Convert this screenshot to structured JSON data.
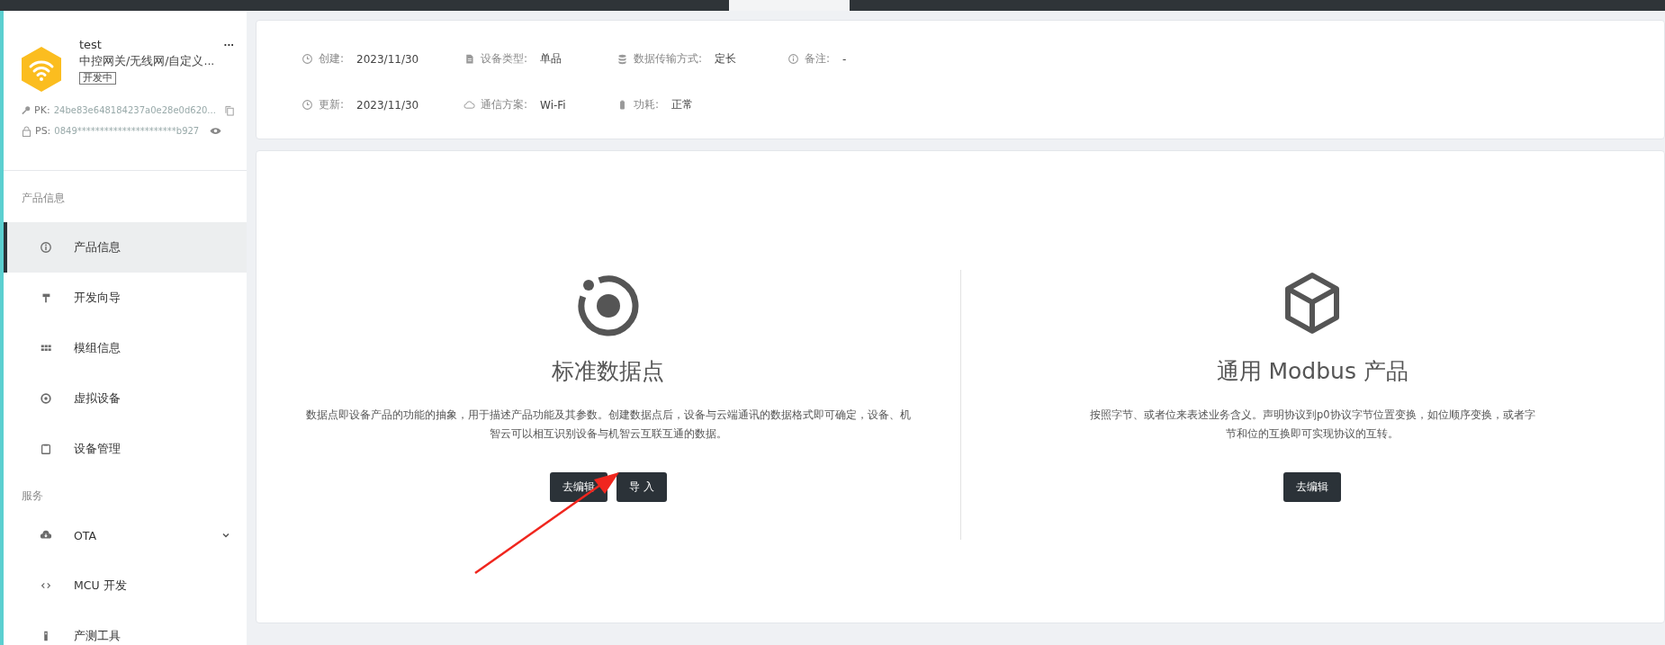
{
  "product": {
    "name": "test",
    "category": "中控网关/无线网/自定义...",
    "status_badge": "开发中",
    "more": "...",
    "pk_label": "PK:",
    "pk_value": "24be83e648184237a0e28e0d620...",
    "ps_label": "PS:",
    "ps_value": "0849**********************b927"
  },
  "sidebar": {
    "groups": [
      {
        "label": "产品信息",
        "items": [
          {
            "label": "产品信息",
            "selected": true
          },
          {
            "label": "开发向导",
            "selected": false
          },
          {
            "label": "模组信息",
            "selected": false
          },
          {
            "label": "虚拟设备",
            "selected": false
          },
          {
            "label": "设备管理",
            "selected": false
          }
        ]
      },
      {
        "label": "服务",
        "items": [
          {
            "label": "OTA",
            "selected": false,
            "submenu": true
          },
          {
            "label": "MCU 开发",
            "selected": false
          },
          {
            "label": "产测工具",
            "selected": false
          }
        ]
      }
    ]
  },
  "info": {
    "rows": [
      [
        {
          "label": "创建:",
          "value": "2023/11/30"
        },
        {
          "label": "设备类型:",
          "value": "单品"
        },
        {
          "label": "数据传输方式:",
          "value": "定长"
        },
        {
          "label": "备注:",
          "value": "-"
        }
      ],
      [
        {
          "label": "更新:",
          "value": "2023/11/30"
        },
        {
          "label": "通信方案:",
          "value": "Wi-Fi"
        },
        {
          "label": "功耗:",
          "value": "正常"
        }
      ]
    ]
  },
  "options": [
    {
      "title": "标准数据点",
      "description": "数据点即设备产品的功能的抽象，用于描述产品功能及其参数。创建数据点后，设备与云端通讯的数据格式即可确定，设备、机智云可以相互识别设备与机智云互联互通的数据。",
      "buttons": [
        "去编辑",
        "导 入"
      ]
    },
    {
      "title": "通用 Modbus 产品",
      "description": "按照字节、或者位来表述业务含义。声明协议到p0协议字节位置变换，如位顺序变换，或者字节和位的互换即可实现协议的互转。",
      "buttons": [
        "去编辑"
      ]
    }
  ]
}
